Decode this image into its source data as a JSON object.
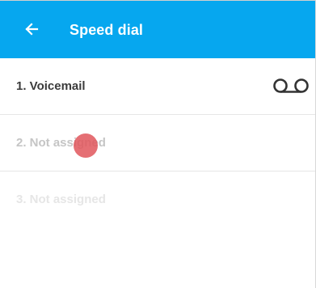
{
  "app_bar": {
    "title": "Speed dial",
    "background_color": "#06a7ef",
    "back_icon": "arrow-left-icon"
  },
  "speed_dial": {
    "entries": [
      {
        "label": "1. Voicemail",
        "icon": "voicemail-icon",
        "state": "assigned"
      },
      {
        "label": "2. Not assigned",
        "state": "unassigned"
      },
      {
        "label": "3. Not assigned",
        "state": "unassigned"
      }
    ]
  }
}
